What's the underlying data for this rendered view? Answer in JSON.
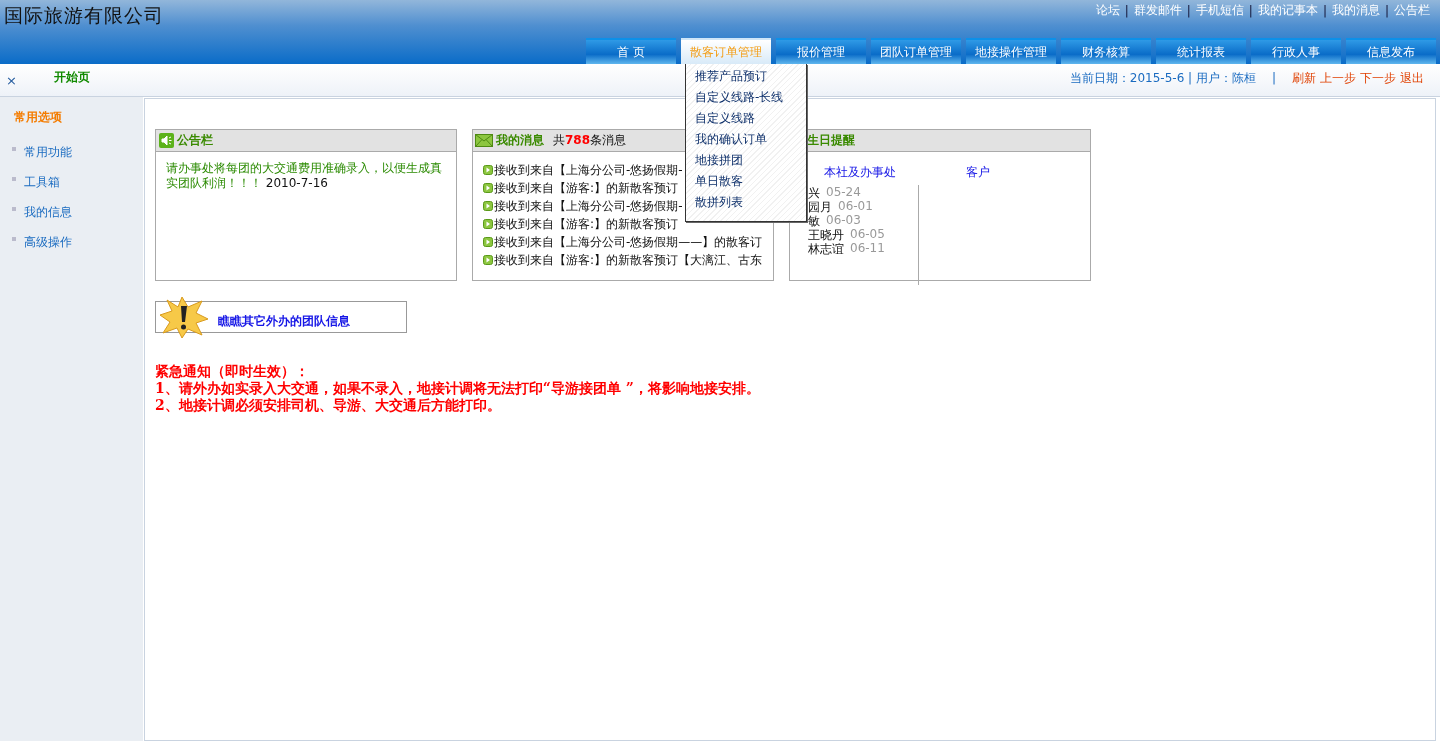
{
  "header": {
    "title": "国际旅游有限公司",
    "top_links": [
      "论坛",
      "群发邮件",
      "手机短信",
      "我的记事本",
      "我的消息",
      "公告栏"
    ],
    "separator": "|"
  },
  "nav": [
    {
      "label": "首 页",
      "selected": false
    },
    {
      "label": "散客订单管理",
      "selected": true
    },
    {
      "label": "报价管理",
      "selected": false
    },
    {
      "label": "团队订单管理",
      "selected": false
    },
    {
      "label": "地接操作管理",
      "selected": false
    },
    {
      "label": "财务核算",
      "selected": false
    },
    {
      "label": "统计报表",
      "selected": false
    },
    {
      "label": "行政人事",
      "selected": false
    },
    {
      "label": "信息发布",
      "selected": false
    }
  ],
  "dropdown": {
    "items": [
      "推荐产品预订",
      "自定义线路-长线",
      "自定义线路",
      "我的确认订单",
      "地接拼团",
      "单日散客",
      "散拼列表"
    ]
  },
  "tab_bar": {
    "close": "×",
    "tab": "开始页",
    "status": "当前日期：2015-5-6 | 用户：陈桓",
    "separator": "|",
    "actions": [
      "刷新",
      "上一步",
      "下一步",
      "退出"
    ]
  },
  "sidebar": {
    "title": "常用选项",
    "items": [
      "常用功能",
      "工具箱",
      "我的信息",
      "高级操作"
    ]
  },
  "notice_card": {
    "title": "公告栏",
    "text": "请办事处将每团的大交通费用准确录入，以便生成真实团队利润！！！",
    "date": "2010-7-16"
  },
  "message_card": {
    "title": "我的消息",
    "count_prefix": "共",
    "count": "788",
    "count_suffix": "条消息",
    "messages": [
      "接收到来自【上海分公司-悠扬假期-",
      "接收到来自【游客:】的新散客预订",
      "接收到来自【上海分公司-悠扬假期-",
      "接收到来自【游客:】的新散客预订",
      "接收到来自【上海分公司-悠扬假期——】的散客订",
      "接收到来自【游客:】的新散客预订【大漓江、古东"
    ]
  },
  "birthday_card": {
    "title": "生日提醒",
    "columns": [
      "本社及办事处",
      "客户"
    ],
    "entries": [
      {
        "name": "兴",
        "date": "05-24"
      },
      {
        "name": "园月",
        "date": "06-01"
      },
      {
        "name": "敏",
        "date": "06-03"
      },
      {
        "name": "王晓丹",
        "date": "06-05"
      },
      {
        "name": "林志谊",
        "date": "06-11"
      }
    ]
  },
  "team_link": "瞧瞧其它外办的团队信息",
  "urgent_notice": [
    "紧急通知（即时生效）：",
    "1、请外办如实录入大交通，如果不录入，地接计调将无法打印“导游接团单 ”，将影响地接安排。",
    "2、地接计调必须安排司机、导游、大交通后方能打印。"
  ]
}
